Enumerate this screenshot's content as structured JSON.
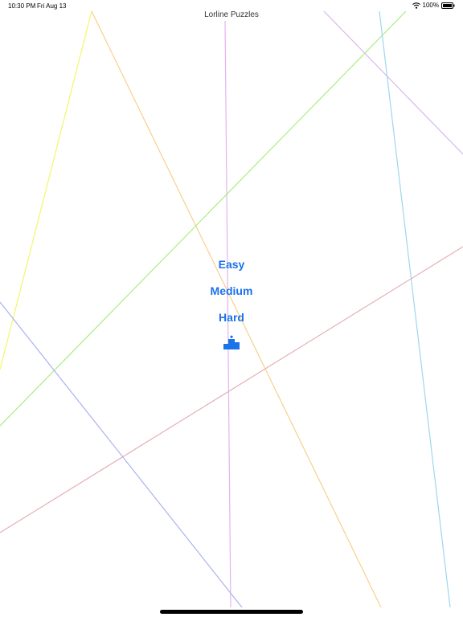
{
  "status_bar": {
    "time": "10:30 PM",
    "date": "Fri Aug 13",
    "battery": "100%"
  },
  "app": {
    "title": "Lorline Puzzles"
  },
  "menu": {
    "easy_label": "Easy",
    "medium_label": "Medium",
    "hard_label": "Hard"
  },
  "icons": {
    "leaderboard": "leaderboard-icon",
    "wifi": "wifi-icon",
    "battery": "battery-icon"
  },
  "colors": {
    "accent": "#1a73e8",
    "line_colors": [
      "#f5f56b",
      "#f8d08c",
      "#e4b3ee",
      "#a8ee80",
      "#d6b6ee",
      "#9fd6ee",
      "#e6b1b6",
      "#aab2ee"
    ]
  }
}
